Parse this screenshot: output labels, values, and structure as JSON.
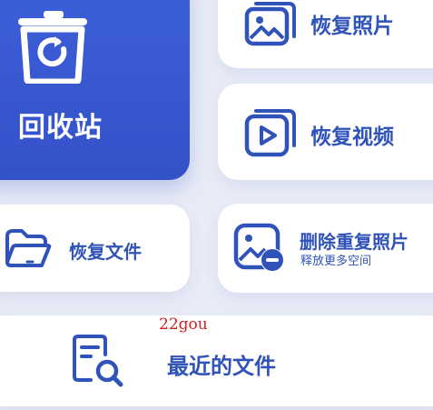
{
  "tiles": {
    "recycle_bin": {
      "label": "回收站"
    },
    "restore_photos": {
      "label": "恢复照片"
    },
    "restore_videos": {
      "label": "恢复视频"
    },
    "restore_files": {
      "label": "恢复文件"
    },
    "delete_duplicates": {
      "label": "删除重复照片",
      "sublabel": "释放更多空间"
    },
    "recent_files": {
      "label": "最近的文件"
    }
  },
  "watermark": "22gou",
  "colors": {
    "accent": "#3452c8",
    "icon_blue": "#2f53b8",
    "background": "#e9ecf7",
    "card": "#ffffff"
  },
  "icons": [
    "trash-restore-icon",
    "photo-icon",
    "video-icon",
    "folder-icon",
    "duplicate-photo-remove-icon",
    "document-search-icon"
  ]
}
